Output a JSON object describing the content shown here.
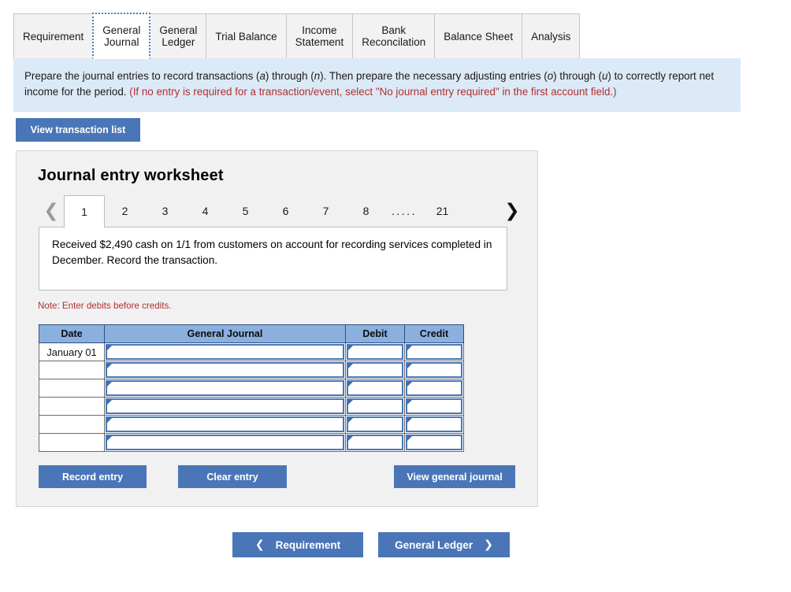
{
  "tabs": [
    {
      "label": "Requirement",
      "active": false
    },
    {
      "label": "General\nJournal",
      "active": true
    },
    {
      "label": "General\nLedger",
      "active": false
    },
    {
      "label": "Trial Balance",
      "active": false
    },
    {
      "label": "Income\nStatement",
      "active": false
    },
    {
      "label": "Bank\nReconcilation",
      "active": false
    },
    {
      "label": "Balance Sheet",
      "active": false
    },
    {
      "label": "Analysis",
      "active": false
    }
  ],
  "instructions": {
    "part1": "Prepare the journal entries to record transactions (",
    "italic_a": "a",
    "part2": ") through (",
    "italic_n": "n",
    "part3": "). Then prepare the necessary adjusting entries (",
    "italic_o": "o",
    "part4": ") through (",
    "italic_u": "u",
    "part5": ") to correctly report net income for the period. ",
    "red_note": "(If no entry is required for a transaction/event, select \"No journal entry required\" in the first account field.)"
  },
  "toolbar": {
    "view_transaction_list": "View transaction list"
  },
  "worksheet": {
    "title": "Journal entry worksheet",
    "pager": {
      "prev_icon": "chevron-left",
      "next_icon": "chevron-right",
      "pages": [
        "1",
        "2",
        "3",
        "4",
        "5",
        "6",
        "7",
        "8"
      ],
      "ellipsis": ".....",
      "last_page": "21",
      "active_page": "1"
    },
    "description": "Received $2,490 cash on 1/1 from customers on account for recording services completed in December. Record the transaction.",
    "note": "Note: Enter debits before credits.",
    "table": {
      "headers": [
        "Date",
        "General Journal",
        "Debit",
        "Credit"
      ],
      "rows": [
        {
          "date": "January 01",
          "general_journal": "",
          "debit": "",
          "credit": ""
        },
        {
          "date": "",
          "general_journal": "",
          "debit": "",
          "credit": ""
        },
        {
          "date": "",
          "general_journal": "",
          "debit": "",
          "credit": ""
        },
        {
          "date": "",
          "general_journal": "",
          "debit": "",
          "credit": ""
        },
        {
          "date": "",
          "general_journal": "",
          "debit": "",
          "credit": ""
        },
        {
          "date": "",
          "general_journal": "",
          "debit": "",
          "credit": ""
        }
      ]
    },
    "buttons": {
      "record_entry": "Record entry",
      "clear_entry": "Clear entry",
      "view_general_journal": "View general journal"
    }
  },
  "bottom_nav": {
    "prev_label": "Requirement",
    "prev_icon": "chevron-left",
    "next_label": "General Ledger",
    "next_icon": "chevron-right"
  },
  "colors": {
    "accent_blue": "#4a76b8",
    "table_header_blue": "#8cb0de",
    "info_panel_blue": "#dce9f6",
    "red_text": "#b03030",
    "panel_gray": "#f1f1f1"
  }
}
